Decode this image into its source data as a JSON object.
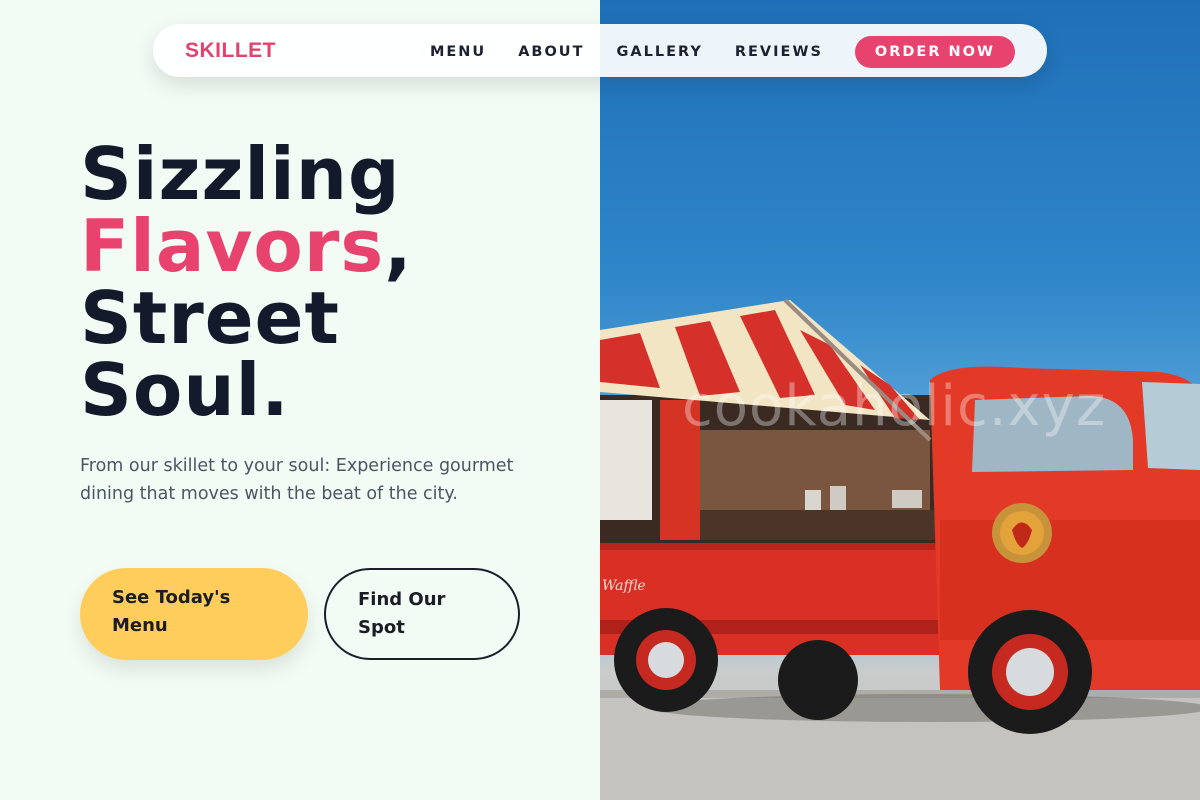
{
  "nav": {
    "brand": "SKILLET",
    "links": [
      "MENU",
      "ABOUT",
      "GALLERY",
      "REVIEWS"
    ],
    "cta": "ORDER NOW"
  },
  "hero": {
    "headline_line1": "Sizzling",
    "headline_accent": "Flavors",
    "headline_comma": ",",
    "headline_line3": "Street",
    "headline_line4": "Soul.",
    "subtitle": "From our skillet to your soul: Experience gourmet dining that moves with the beat of the city.",
    "primary_button": "See Today's Menu",
    "secondary_button": "Find Our Spot"
  },
  "image": {
    "watermark": "cookaholic.xyz",
    "truck_text": "Waffle"
  },
  "colors": {
    "accent": "#e8436e",
    "primary_button": "#ffcd5c",
    "dark_text": "#121a2c",
    "background": "#f3fcf4"
  }
}
